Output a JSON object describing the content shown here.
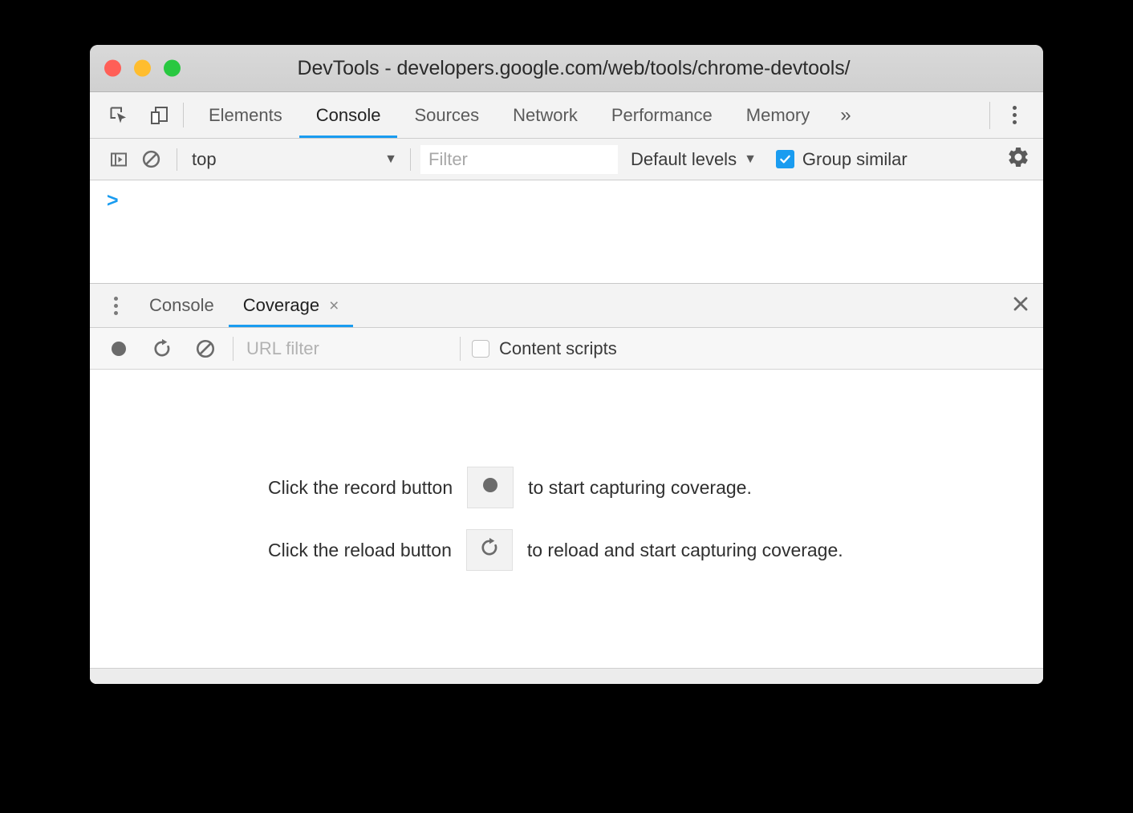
{
  "window": {
    "title": "DevTools - developers.google.com/web/tools/chrome-devtools/",
    "controls": {
      "close": "close",
      "minimize": "minimize",
      "maximize": "maximize"
    },
    "accent_color": "#1a9cf0",
    "titlebar_color": "#d4d4d4",
    "toolbar_color": "#f3f3f3"
  },
  "main_toolbar": {
    "inspect_icon": "inspect-element-icon",
    "device_icon": "device-toolbar-icon",
    "tabs": [
      {
        "label": "Elements",
        "active": false
      },
      {
        "label": "Console",
        "active": true
      },
      {
        "label": "Sources",
        "active": false
      },
      {
        "label": "Network",
        "active": false
      },
      {
        "label": "Performance",
        "active": false
      },
      {
        "label": "Memory",
        "active": false
      }
    ],
    "more_tabs_label": "»",
    "main_menu_icon": "kebab-menu-icon"
  },
  "console_toolbar": {
    "sidebar_icon": "console-sidebar-icon",
    "clear_icon": "clear-console-icon",
    "context_selected": "top",
    "context_caret": "▼",
    "filter_placeholder": "Filter",
    "filter_value": "",
    "levels_label": "Default levels",
    "levels_caret": "▼",
    "group_similar_label": "Group similar",
    "group_similar_checked": true,
    "settings_icon": "gear-icon"
  },
  "console_body": {
    "prompt": ">"
  },
  "drawer": {
    "menu_icon": "kebab-menu-icon",
    "tabs": [
      {
        "label": "Console",
        "active": false,
        "closable": false
      },
      {
        "label": "Coverage",
        "active": true,
        "closable": true,
        "close_glyph": "×"
      }
    ],
    "close_drawer_glyph": "✕"
  },
  "coverage_toolbar": {
    "record_icon": "record-icon",
    "reload_icon": "reload-icon",
    "clear_icon": "clear-icon",
    "url_filter_placeholder": "URL filter",
    "url_filter_value": "",
    "content_scripts_label": "Content scripts",
    "content_scripts_checked": false
  },
  "coverage_empty_state": {
    "rows": [
      {
        "prefix": "Click the record button",
        "icon": "record-icon",
        "suffix": "to start capturing coverage."
      },
      {
        "prefix": "Click the reload button",
        "icon": "reload-icon",
        "suffix": "to reload and start capturing coverage."
      }
    ]
  }
}
